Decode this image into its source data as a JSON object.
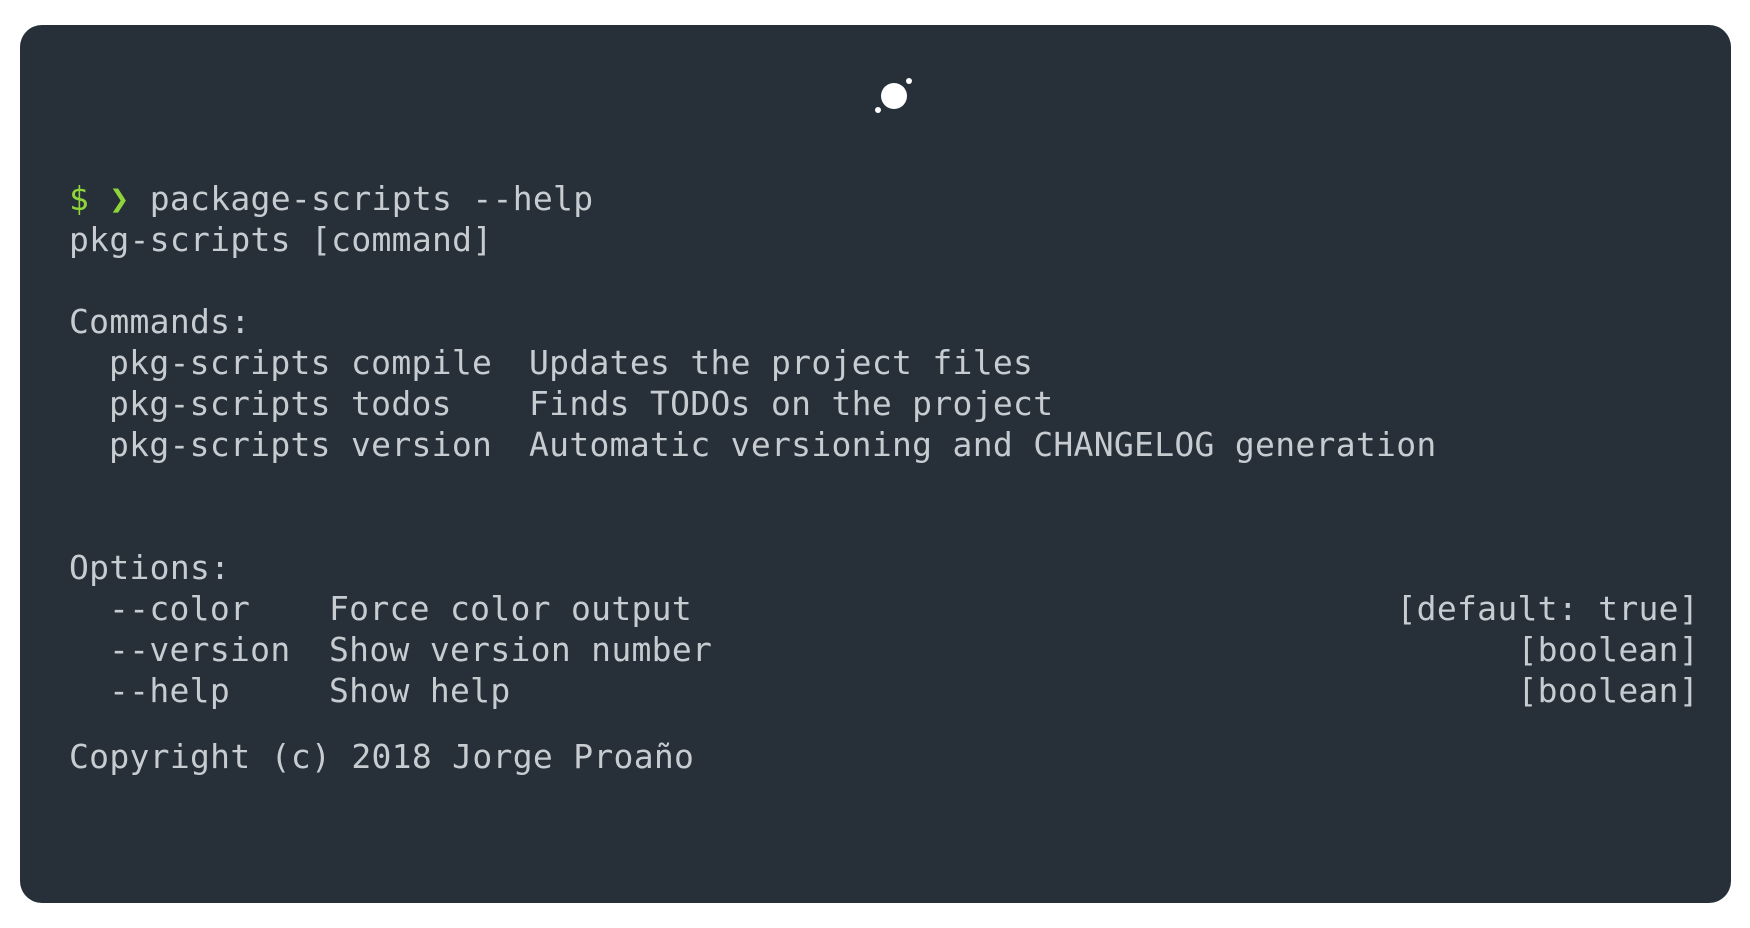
{
  "logo": {
    "icon": "planet-dot-icon"
  },
  "prompt": {
    "symbol": "$",
    "arrow": "❯",
    "command": "package-scripts --help"
  },
  "usage": "pkg-scripts [command]",
  "commands": {
    "heading": "Commands:",
    "items": [
      {
        "name": "pkg-scripts compile",
        "description": "Updates the project files"
      },
      {
        "name": "pkg-scripts todos",
        "description": "Finds TODOs on the project"
      },
      {
        "name": "pkg-scripts version",
        "description": "Automatic versioning and CHANGELOG generation"
      }
    ]
  },
  "options": {
    "heading": "Options:",
    "items": [
      {
        "name": "--color",
        "description": "Force color output",
        "type": "[default: true]"
      },
      {
        "name": "--version",
        "description": "Show version number",
        "type": "[boolean]"
      },
      {
        "name": "--help",
        "description": "Show help",
        "type": "[boolean]"
      }
    ]
  },
  "copyright": "Copyright (c) 2018 Jorge Proaño",
  "colors": {
    "background": "#273039",
    "text": "#c7ccd1",
    "prompt": "#8fd53a"
  }
}
